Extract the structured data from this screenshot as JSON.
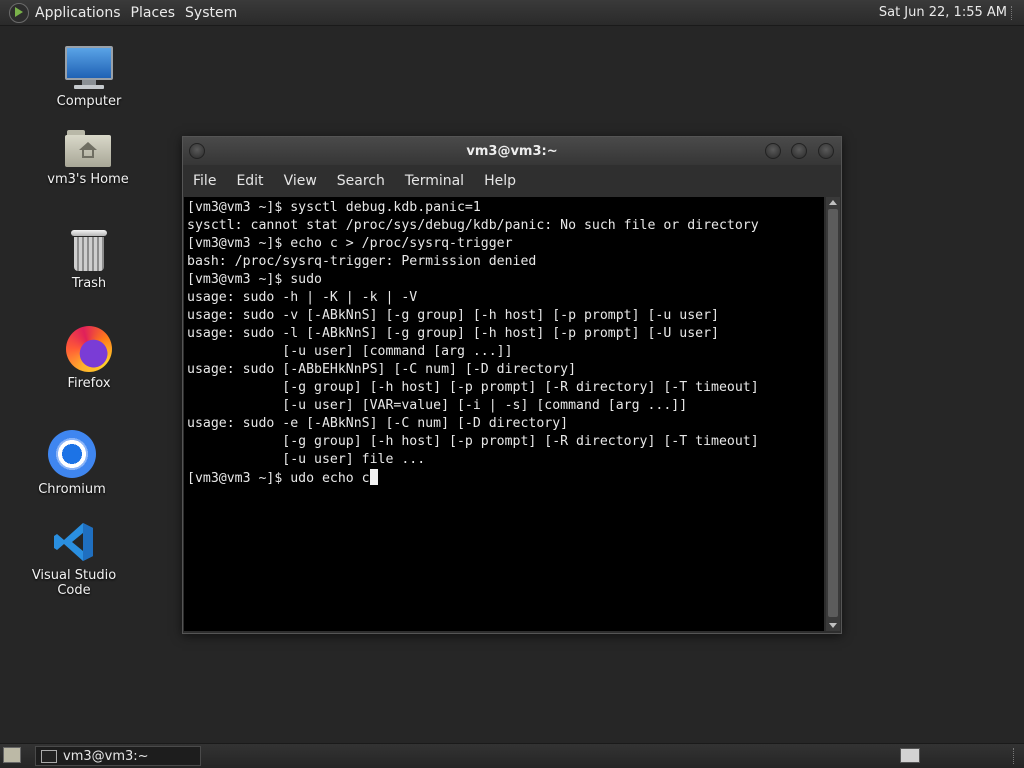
{
  "top_panel": {
    "menus": [
      "Applications",
      "Places",
      "System"
    ],
    "clock": "Sat Jun 22,  1:55 AM"
  },
  "desktop_icons": [
    {
      "label": "Computer",
      "icon": "computer-icon"
    },
    {
      "label": "vm3's Home",
      "icon": "home-folder-icon"
    },
    {
      "label": "Trash",
      "icon": "trash-icon"
    },
    {
      "label": "Firefox",
      "icon": "firefox-icon"
    },
    {
      "label": "Chromium",
      "icon": "chromium-icon"
    },
    {
      "label": "Visual Studio Code",
      "icon": "vscode-icon"
    }
  ],
  "terminal": {
    "title": "vm3@vm3:~",
    "menu": [
      "File",
      "Edit",
      "View",
      "Search",
      "Terminal",
      "Help"
    ],
    "lines": [
      "[vm3@vm3 ~]$ sysctl debug.kdb.panic=1",
      "sysctl: cannot stat /proc/sys/debug/kdb/panic: No such file or directory",
      "[vm3@vm3 ~]$ echo c > /proc/sysrq-trigger",
      "bash: /proc/sysrq-trigger: Permission denied",
      "[vm3@vm3 ~]$ sudo",
      "usage: sudo -h | -K | -k | -V",
      "usage: sudo -v [-ABkNnS] [-g group] [-h host] [-p prompt] [-u user]",
      "usage: sudo -l [-ABkNnS] [-g group] [-h host] [-p prompt] [-U user]",
      "            [-u user] [command [arg ...]]",
      "usage: sudo [-ABbEHkNnPS] [-C num] [-D directory]",
      "            [-g group] [-h host] [-p prompt] [-R directory] [-T timeout]",
      "            [-u user] [VAR=value] [-i | -s] [command [arg ...]]",
      "usage: sudo -e [-ABkNnS] [-C num] [-D directory]",
      "            [-g group] [-h host] [-p prompt] [-R directory] [-T timeout]",
      "            [-u user] file ..."
    ],
    "current_input": "[vm3@vm3 ~]$ udo echo c"
  },
  "taskbar": {
    "window_button_label": "vm3@vm3:~"
  }
}
